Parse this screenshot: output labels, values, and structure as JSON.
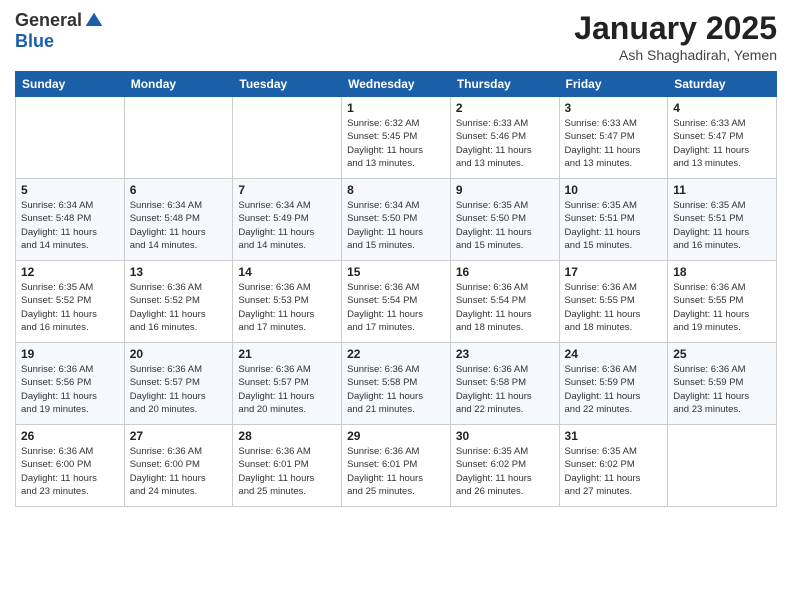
{
  "logo": {
    "general": "General",
    "blue": "Blue"
  },
  "header": {
    "month": "January 2025",
    "location": "Ash Shaghadirah, Yemen"
  },
  "days_of_week": [
    "Sunday",
    "Monday",
    "Tuesday",
    "Wednesday",
    "Thursday",
    "Friday",
    "Saturday"
  ],
  "weeks": [
    [
      {
        "day": "",
        "info": ""
      },
      {
        "day": "",
        "info": ""
      },
      {
        "day": "",
        "info": ""
      },
      {
        "day": "1",
        "info": "Sunrise: 6:32 AM\nSunset: 5:45 PM\nDaylight: 11 hours\nand 13 minutes."
      },
      {
        "day": "2",
        "info": "Sunrise: 6:33 AM\nSunset: 5:46 PM\nDaylight: 11 hours\nand 13 minutes."
      },
      {
        "day": "3",
        "info": "Sunrise: 6:33 AM\nSunset: 5:47 PM\nDaylight: 11 hours\nand 13 minutes."
      },
      {
        "day": "4",
        "info": "Sunrise: 6:33 AM\nSunset: 5:47 PM\nDaylight: 11 hours\nand 13 minutes."
      }
    ],
    [
      {
        "day": "5",
        "info": "Sunrise: 6:34 AM\nSunset: 5:48 PM\nDaylight: 11 hours\nand 14 minutes."
      },
      {
        "day": "6",
        "info": "Sunrise: 6:34 AM\nSunset: 5:48 PM\nDaylight: 11 hours\nand 14 minutes."
      },
      {
        "day": "7",
        "info": "Sunrise: 6:34 AM\nSunset: 5:49 PM\nDaylight: 11 hours\nand 14 minutes."
      },
      {
        "day": "8",
        "info": "Sunrise: 6:34 AM\nSunset: 5:50 PM\nDaylight: 11 hours\nand 15 minutes."
      },
      {
        "day": "9",
        "info": "Sunrise: 6:35 AM\nSunset: 5:50 PM\nDaylight: 11 hours\nand 15 minutes."
      },
      {
        "day": "10",
        "info": "Sunrise: 6:35 AM\nSunset: 5:51 PM\nDaylight: 11 hours\nand 15 minutes."
      },
      {
        "day": "11",
        "info": "Sunrise: 6:35 AM\nSunset: 5:51 PM\nDaylight: 11 hours\nand 16 minutes."
      }
    ],
    [
      {
        "day": "12",
        "info": "Sunrise: 6:35 AM\nSunset: 5:52 PM\nDaylight: 11 hours\nand 16 minutes."
      },
      {
        "day": "13",
        "info": "Sunrise: 6:36 AM\nSunset: 5:52 PM\nDaylight: 11 hours\nand 16 minutes."
      },
      {
        "day": "14",
        "info": "Sunrise: 6:36 AM\nSunset: 5:53 PM\nDaylight: 11 hours\nand 17 minutes."
      },
      {
        "day": "15",
        "info": "Sunrise: 6:36 AM\nSunset: 5:54 PM\nDaylight: 11 hours\nand 17 minutes."
      },
      {
        "day": "16",
        "info": "Sunrise: 6:36 AM\nSunset: 5:54 PM\nDaylight: 11 hours\nand 18 minutes."
      },
      {
        "day": "17",
        "info": "Sunrise: 6:36 AM\nSunset: 5:55 PM\nDaylight: 11 hours\nand 18 minutes."
      },
      {
        "day": "18",
        "info": "Sunrise: 6:36 AM\nSunset: 5:55 PM\nDaylight: 11 hours\nand 19 minutes."
      }
    ],
    [
      {
        "day": "19",
        "info": "Sunrise: 6:36 AM\nSunset: 5:56 PM\nDaylight: 11 hours\nand 19 minutes."
      },
      {
        "day": "20",
        "info": "Sunrise: 6:36 AM\nSunset: 5:57 PM\nDaylight: 11 hours\nand 20 minutes."
      },
      {
        "day": "21",
        "info": "Sunrise: 6:36 AM\nSunset: 5:57 PM\nDaylight: 11 hours\nand 20 minutes."
      },
      {
        "day": "22",
        "info": "Sunrise: 6:36 AM\nSunset: 5:58 PM\nDaylight: 11 hours\nand 21 minutes."
      },
      {
        "day": "23",
        "info": "Sunrise: 6:36 AM\nSunset: 5:58 PM\nDaylight: 11 hours\nand 22 minutes."
      },
      {
        "day": "24",
        "info": "Sunrise: 6:36 AM\nSunset: 5:59 PM\nDaylight: 11 hours\nand 22 minutes."
      },
      {
        "day": "25",
        "info": "Sunrise: 6:36 AM\nSunset: 5:59 PM\nDaylight: 11 hours\nand 23 minutes."
      }
    ],
    [
      {
        "day": "26",
        "info": "Sunrise: 6:36 AM\nSunset: 6:00 PM\nDaylight: 11 hours\nand 23 minutes."
      },
      {
        "day": "27",
        "info": "Sunrise: 6:36 AM\nSunset: 6:00 PM\nDaylight: 11 hours\nand 24 minutes."
      },
      {
        "day": "28",
        "info": "Sunrise: 6:36 AM\nSunset: 6:01 PM\nDaylight: 11 hours\nand 25 minutes."
      },
      {
        "day": "29",
        "info": "Sunrise: 6:36 AM\nSunset: 6:01 PM\nDaylight: 11 hours\nand 25 minutes."
      },
      {
        "day": "30",
        "info": "Sunrise: 6:35 AM\nSunset: 6:02 PM\nDaylight: 11 hours\nand 26 minutes."
      },
      {
        "day": "31",
        "info": "Sunrise: 6:35 AM\nSunset: 6:02 PM\nDaylight: 11 hours\nand 27 minutes."
      },
      {
        "day": "",
        "info": ""
      }
    ]
  ]
}
